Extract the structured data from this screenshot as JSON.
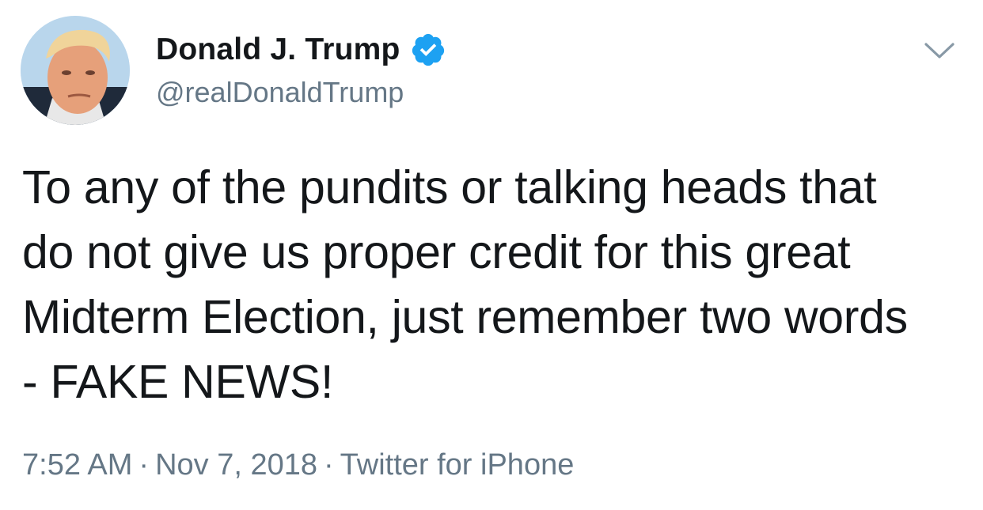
{
  "author": {
    "display_name": "Donald J. Trump",
    "handle": "@realDonaldTrump",
    "verified": true,
    "verified_color": "#1da1f2"
  },
  "tweet": {
    "lines": [
      "To any of the pundits or talking heads that",
      "do not give us proper credit for this great",
      "Midterm Election, just remember two words",
      "- FAKE NEWS!"
    ]
  },
  "meta": {
    "time": "7:52 AM",
    "separator": "·",
    "date": "Nov 7, 2018",
    "source": "Twitter for iPhone"
  },
  "icons": {
    "menu": "chevron-down-icon",
    "badge": "verified-badge-icon"
  },
  "colors": {
    "text_primary": "#14171a",
    "text_secondary": "#657786",
    "accent": "#1da1f2"
  }
}
